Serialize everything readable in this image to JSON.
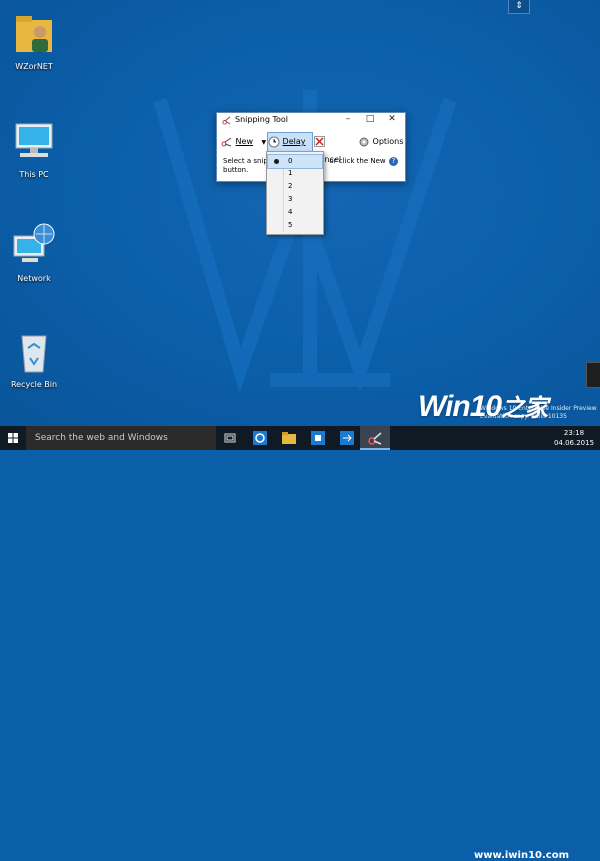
{
  "desktop_icons": [
    {
      "label": "WZorNET",
      "icon": "user-folder-icon"
    },
    {
      "label": "This PC",
      "icon": "computer-icon"
    },
    {
      "label": "Network",
      "icon": "network-icon"
    },
    {
      "label": "Recycle Bin",
      "icon": "recycle-bin-icon"
    }
  ],
  "snipping_tool": {
    "title": "Snipping Tool",
    "toolbar": {
      "new_label": "New",
      "delay_label": "Delay",
      "cancel_label": "Cancel",
      "options_label": "Options"
    },
    "description_line1": "Select a snip ty",
    "description_line1b": "or click the New",
    "description_line2": "button."
  },
  "delay_menu": {
    "options": [
      "0",
      "1",
      "2",
      "3",
      "4",
      "5"
    ],
    "selected": "0"
  },
  "branding": {
    "logo_text_win": "Win",
    "logo_text_ten": "10",
    "logo_text_cn": "之家",
    "url": "www.iwin10.com",
    "eval_line1": "Windows 10 Enterprise Insider Preview",
    "eval_line2": "Evaluation copy. Build 10135"
  },
  "taskbar": {
    "search_placeholder": "Search the web and Windows",
    "clock_time": "23:18",
    "clock_date": "04.06.2015"
  },
  "colors": {
    "desktop": "#0b5ea8",
    "taskbar": "#101a24",
    "accent": "#c9e0f7"
  }
}
